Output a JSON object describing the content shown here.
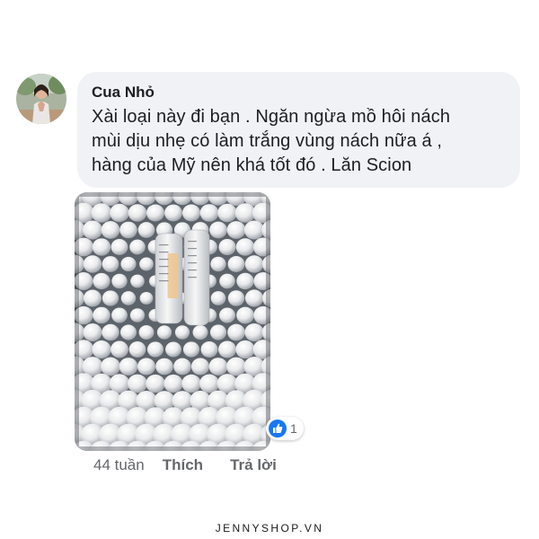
{
  "comment": {
    "author": "Cua Nhỏ",
    "text": "Xài loại này đi bạn . Ngăn ngừa mồ hôi nách\nmùi dịu nhẹ có làm trắng vùng nách nữa á ,\nhàng của Mỹ nên khá tốt đó . Lăn Scion",
    "avatar": "user-photo",
    "photo": "deodorant-bottles-photo",
    "reaction": {
      "icon": "like-icon",
      "count": "1",
      "color": "#1877f2"
    },
    "time": "44 tuần",
    "like_label": "Thích",
    "reply_label": "Trả lời"
  },
  "footer": {
    "brand": "JENNYSHOP.VN"
  },
  "colors": {
    "bubble": "#f0f2f5",
    "secondary_text": "#65676b",
    "primary_text": "#1c1e21"
  }
}
